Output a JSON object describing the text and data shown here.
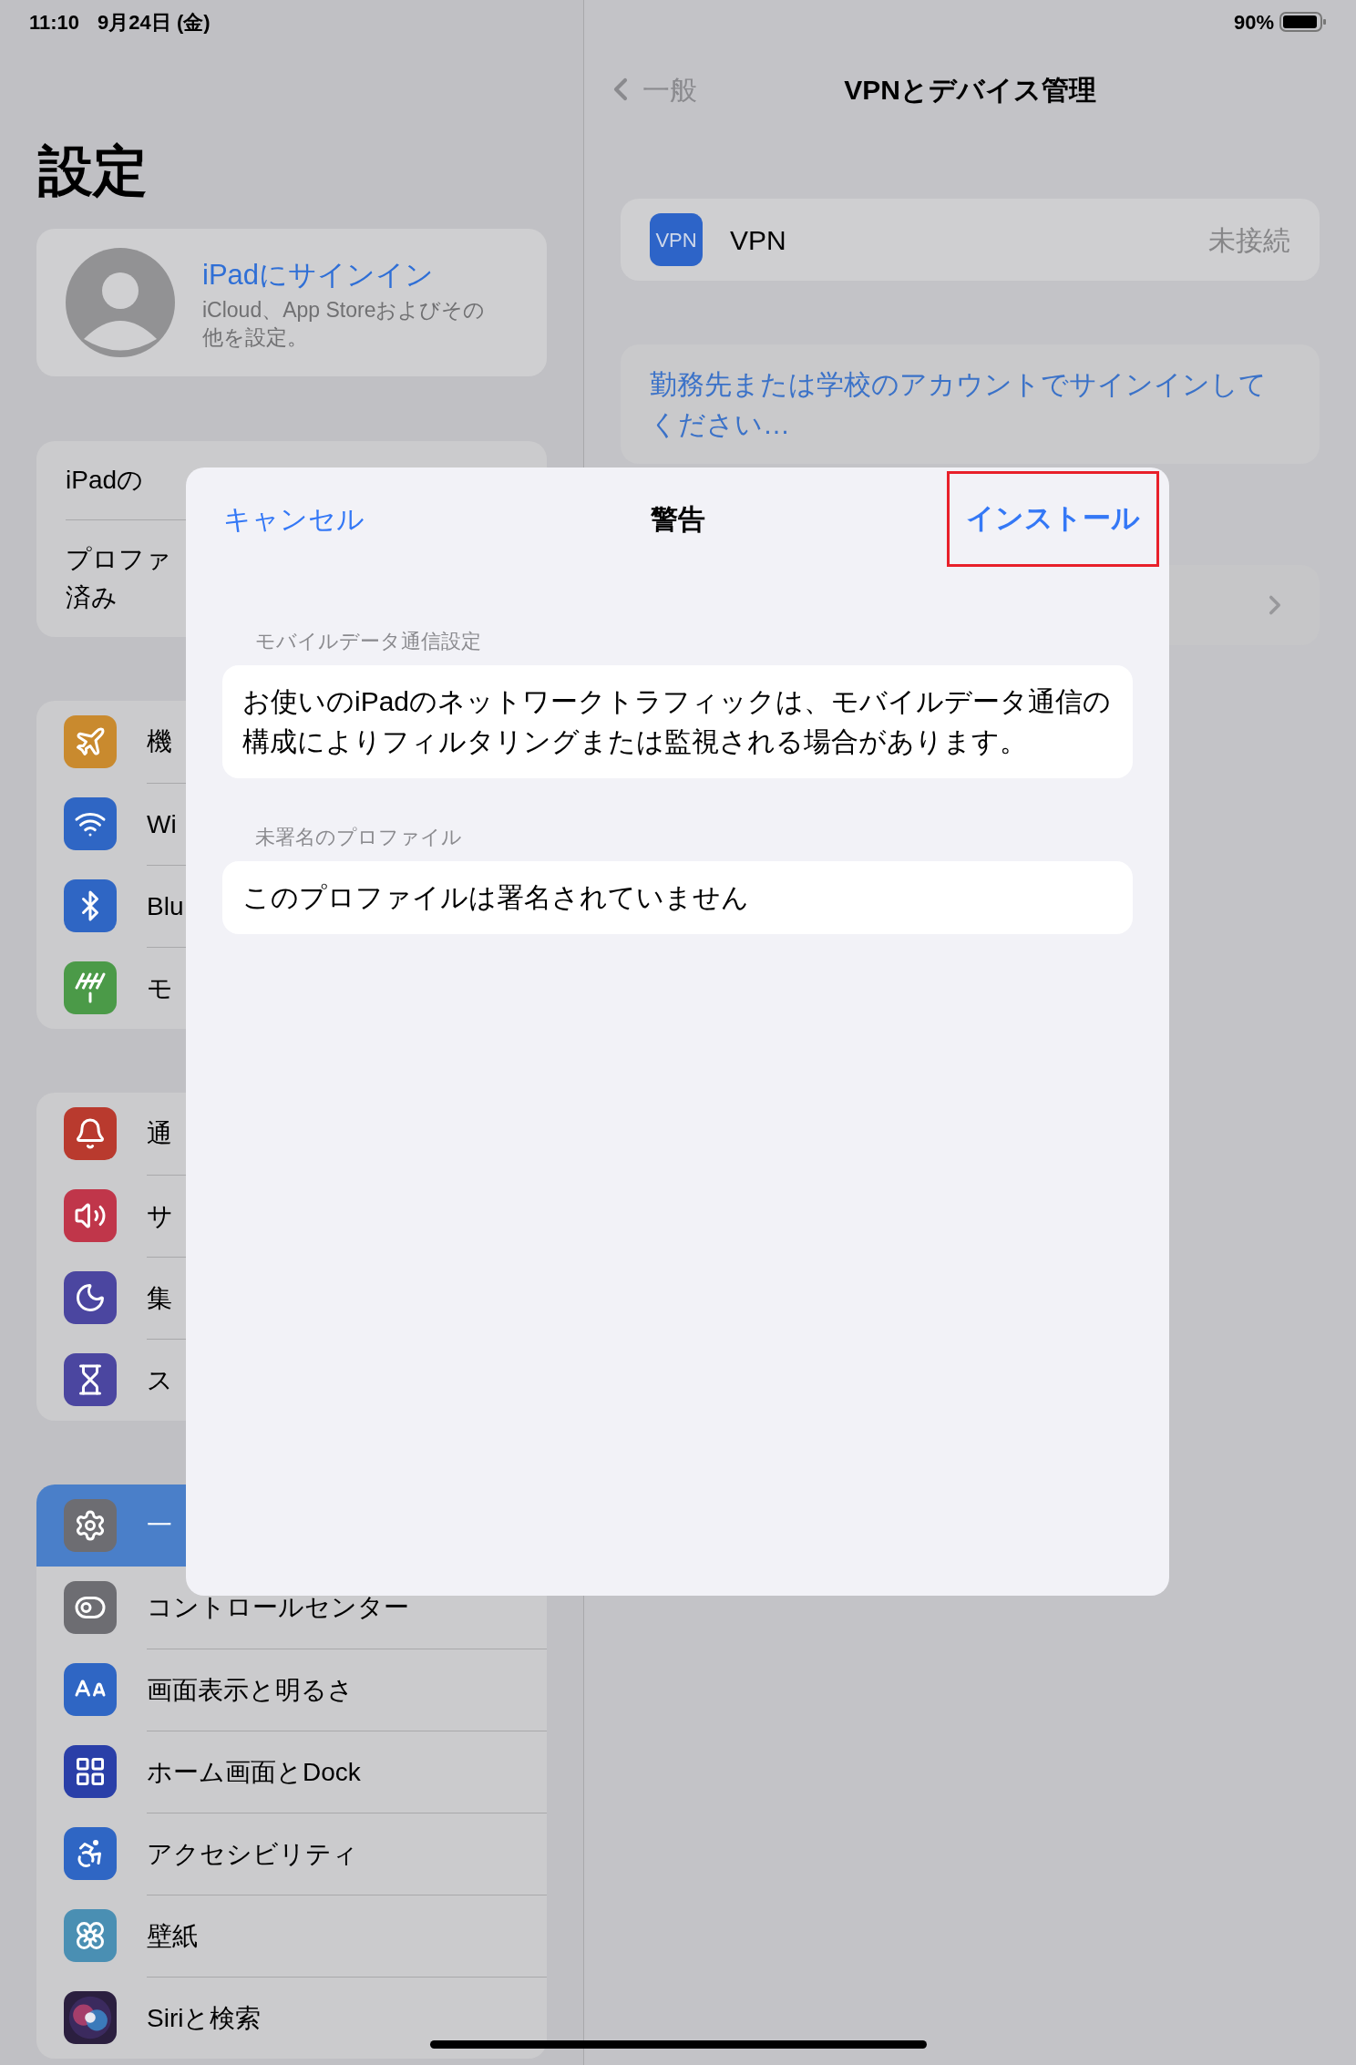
{
  "status_bar": {
    "time": "11:10",
    "date": "9月24日 (金)",
    "battery": "90%"
  },
  "sidebar": {
    "title": "設定",
    "account": {
      "title": "iPadにサインイン",
      "subtitle": "iCloud、App Storeおよびその他を設定。"
    },
    "groups": [
      {
        "rows": [
          {
            "label": "iPadの",
            "selected": false
          },
          {
            "lines": [
              "プロファ",
              "済み"
            ],
            "selected": false
          }
        ]
      },
      {
        "rows": [
          {
            "label": "機",
            "selected": false
          },
          {
            "label": "Wi",
            "selected": false
          },
          {
            "label": "Blu",
            "selected": false
          },
          {
            "label": "モ",
            "selected": false
          }
        ]
      },
      {
        "rows": [
          {
            "label": "通",
            "selected": false
          },
          {
            "label": "サ",
            "selected": false
          },
          {
            "label": "集",
            "selected": false
          },
          {
            "label": "ス",
            "selected": false
          }
        ]
      },
      {
        "rows": [
          {
            "label": "一",
            "selected": true
          },
          {
            "label": "コントロールセンター",
            "selected": false
          },
          {
            "label": "画面表示と明るさ",
            "selected": false
          },
          {
            "label": "ホーム画面とDock",
            "selected": false
          },
          {
            "label": "アクセシビリティ",
            "selected": false
          },
          {
            "label": "壁紙",
            "selected": false
          },
          {
            "label": "Siriと検索",
            "selected": false
          }
        ]
      }
    ]
  },
  "detail": {
    "back": "一般",
    "title": "VPNとデバイス管理",
    "vpn": {
      "badge": "VPN",
      "label": "VPN",
      "value": "未接続"
    },
    "sign_in_link": "勤務先または学校のアカウントでサインインしてください…"
  },
  "modal": {
    "cancel": "キャンセル",
    "title": "警告",
    "install": "インストール",
    "install_highlighted": true,
    "sections": [
      {
        "header": "モバイルデータ通信設定",
        "text": "お使いのiPadのネットワークトラフィックは、モバイルデータ通信の構成によりフィルタリングまたは監視される場合があります。"
      },
      {
        "header": "未署名のプロファイル",
        "text": "このプロファイルは署名されていません"
      }
    ]
  }
}
